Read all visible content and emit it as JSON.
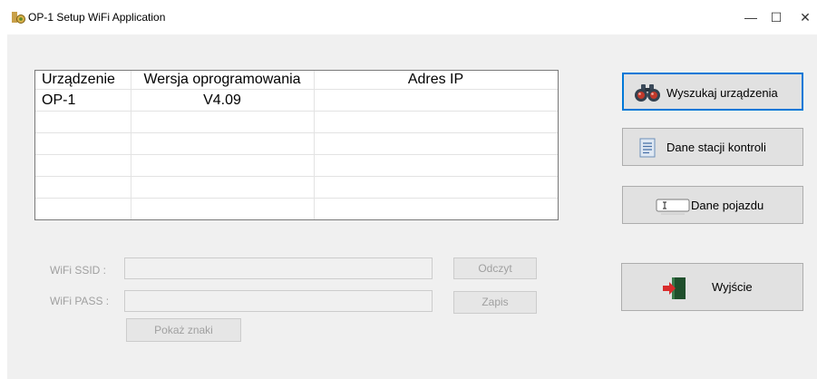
{
  "window": {
    "title": "OP-1 Setup WiFi Application",
    "minimize": "—",
    "maximize": "☐",
    "close": "✕"
  },
  "grid": {
    "columns": [
      "Urządzenie",
      "Wersja oprogramowania",
      "Adres IP"
    ],
    "rows": [
      [
        "OP-1",
        "V4.09",
        ""
      ],
      [
        "",
        "",
        ""
      ],
      [
        "",
        "",
        ""
      ],
      [
        "",
        "",
        ""
      ],
      [
        "",
        "",
        ""
      ],
      [
        "",
        "",
        ""
      ]
    ]
  },
  "buttons": {
    "search": "Wyszukaj urządzenia",
    "station": "Dane stacji kontroli",
    "vehicle": "Dane pojazdu",
    "exit": "Wyjście"
  },
  "wifi": {
    "ssid_label": "WiFi SSID :",
    "ssid_value": "",
    "pass_label": "WiFi PASS :",
    "pass_value": "",
    "read_button": "Odczyt",
    "save_button": "Zapis",
    "show_chars_button": "Pokaż znaki"
  },
  "colors": {
    "window_bg": "#f0f0f0",
    "button_bg": "#e1e1e1",
    "focus_border": "#0078d7",
    "disabled_text": "#a0a0a0"
  },
  "icons": {
    "app": "app-icon",
    "search": "binoculars-icon",
    "station": "document-icon",
    "vehicle": "textbox-icon",
    "exit": "exit-door-icon"
  }
}
